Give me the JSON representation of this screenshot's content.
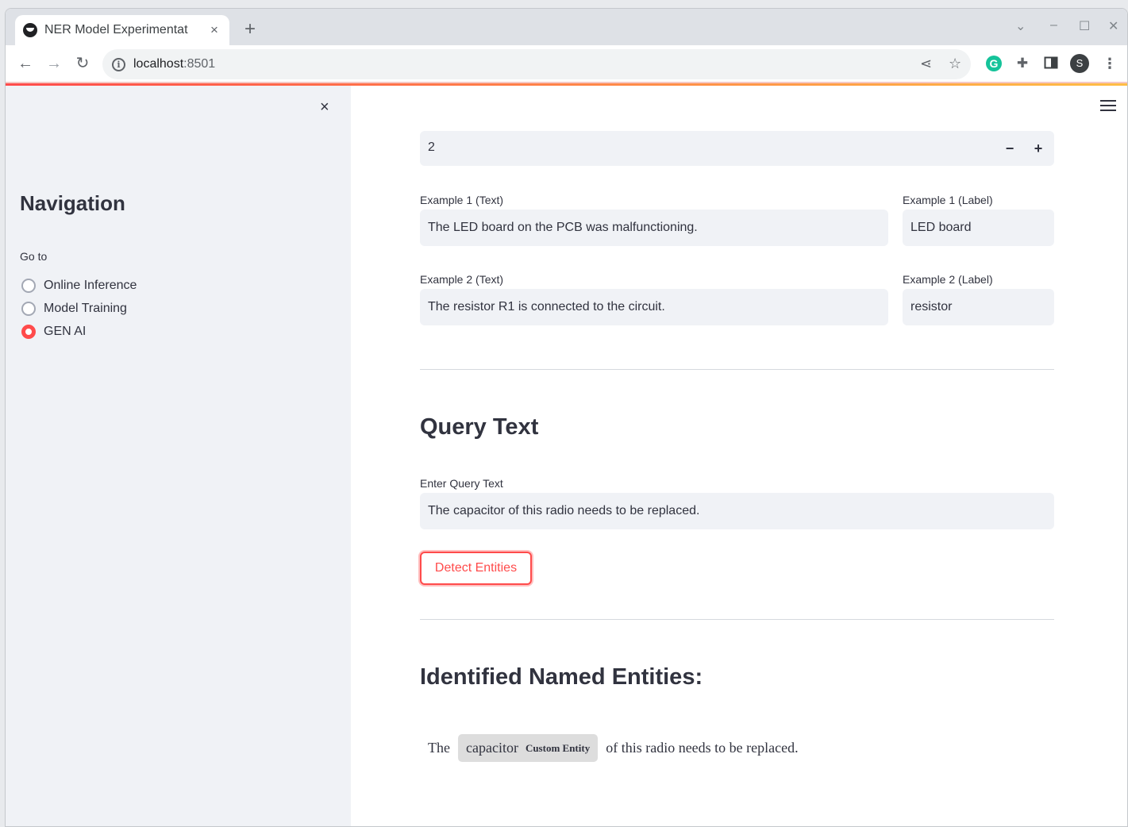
{
  "browser": {
    "tab_title": "NER Model Experimentat",
    "tab_close": "×",
    "new_tab": "+",
    "url_host": "localhost",
    "url_port": ":8501",
    "avatar_initial": "S",
    "extension_g": "G",
    "icons": [
      "back-icon",
      "forward-icon",
      "reload-icon",
      "info-icon",
      "share-icon",
      "star-icon",
      "grammarly-icon",
      "puzzle-icon",
      "side-panel-icon",
      "kebab-menu-icon"
    ]
  },
  "sidebar": {
    "close": "×",
    "title": "Navigation",
    "goto_label": "Go to",
    "options": [
      {
        "label": "Online Inference",
        "selected": false
      },
      {
        "label": "Model Training",
        "selected": false
      },
      {
        "label": "GEN AI",
        "selected": true
      }
    ]
  },
  "main": {
    "num_examples": "2",
    "minus": "−",
    "plus": "+",
    "examples": [
      {
        "text_label": "Example 1 (Text)",
        "text": "The LED board on the PCB was malfunctioning.",
        "entity_label": "Example 1 (Label)",
        "entity": "LED board"
      },
      {
        "text_label": "Example 2 (Text)",
        "text": "The resistor R1 is connected to the circuit.",
        "entity_label": "Example 2 (Label)",
        "entity": "resistor"
      }
    ],
    "query_title": "Query Text",
    "query_label": "Enter Query Text",
    "query_value": "The capacitor of this radio needs to be replaced.",
    "detect_button": "Detect Entities",
    "results_title": "Identified Named Entities:",
    "result": {
      "before": "The",
      "entity_text": "capacitor",
      "entity_type": "Custom Entity",
      "after": "of this radio needs to be replaced."
    }
  },
  "colors": {
    "accent": "#ff4b4b",
    "sidebar_bg": "#f0f2f6",
    "entity_bg": "#dddddd"
  }
}
